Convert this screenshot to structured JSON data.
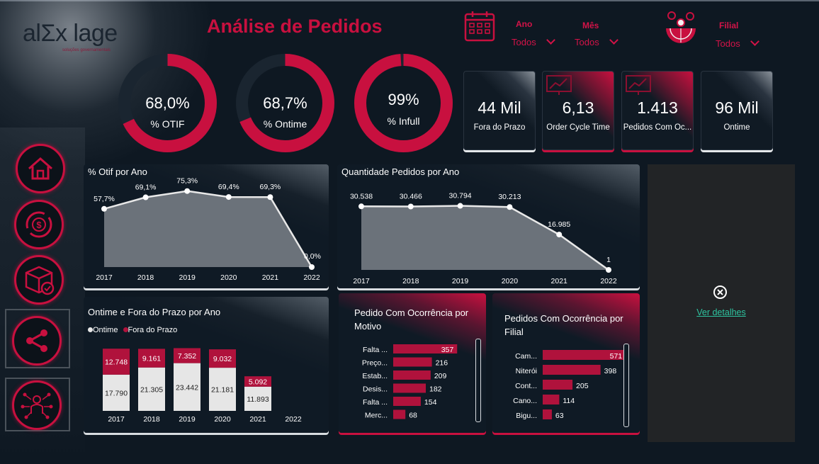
{
  "header": {
    "title": "Análise de Pedidos",
    "logo_text": "alΣx lage",
    "logo_sub": "soluções governamentais"
  },
  "filters": {
    "ano_label": "Ano",
    "ano_value": "Todos",
    "mes_label": "Mês",
    "mes_value": "Todos",
    "filial_label": "Filial",
    "filial_value": "Todos"
  },
  "gauges": [
    {
      "value": "68,0%",
      "label": "% OTIF",
      "fraction": 0.68
    },
    {
      "value": "68,7%",
      "label": "% Ontime",
      "fraction": 0.687
    },
    {
      "value": "99%",
      "label": "% Infull",
      "fraction": 0.99
    }
  ],
  "kpis": [
    {
      "value": "44 Mil",
      "label": "Fora do Prazo"
    },
    {
      "value": "6,13",
      "label": "Order Cycle Time"
    },
    {
      "value": "1.413",
      "label": "Pedidos Com Oc..."
    },
    {
      "value": "96 Mil",
      "label": "Ontime"
    }
  ],
  "nav": {
    "items": [
      "home-icon",
      "money-cycle-icon",
      "box-check-icon",
      "share-icon",
      "network-person-icon"
    ]
  },
  "details": {
    "link": "Ver detalhes"
  },
  "colors": {
    "accent": "#c8103f",
    "background": "#0e1822",
    "area_fill": "#6b727a",
    "ontime_bar": "#e6e6e6",
    "late_bar": "#b0123c"
  },
  "chart_data": [
    {
      "id": "otif",
      "type": "area",
      "title": "% Otif por Ano",
      "x": [
        "2017",
        "2018",
        "2019",
        "2020",
        "2021",
        "2022"
      ],
      "values": [
        57.7,
        69.1,
        75.3,
        69.4,
        69.3,
        0.0
      ],
      "labels": [
        "57,7%",
        "69,1%",
        "75,3%",
        "69,4%",
        "69,3%",
        "0,0%"
      ],
      "ylim": [
        0,
        80
      ]
    },
    {
      "id": "quantidade",
      "type": "area",
      "title": "Quantidade Pedidos por Ano",
      "x": [
        "2017",
        "2018",
        "2019",
        "2020",
        "2021",
        "2022"
      ],
      "values": [
        30538,
        30466,
        30794,
        30213,
        16985,
        1
      ],
      "labels": [
        "30.538",
        "30.466",
        "30.794",
        "30.213",
        "16.985",
        "1"
      ],
      "ylim": [
        0,
        32000
      ]
    },
    {
      "id": "ontime_fora",
      "type": "bar",
      "title": "Ontime e Fora do Prazo por Ano",
      "categories": [
        "2017",
        "2018",
        "2019",
        "2020",
        "2021",
        "2022"
      ],
      "series": [
        {
          "name": "Ontime",
          "values": [
            17790,
            21305,
            23442,
            21181,
            11893,
            null
          ],
          "labels": [
            "17.790",
            "21.305",
            "23.442",
            "21.181",
            "11.893",
            ""
          ]
        },
        {
          "name": "Fora do Prazo",
          "values": [
            12748,
            9161,
            7352,
            9032,
            5092,
            null
          ],
          "labels": [
            "12.748",
            "9.161",
            "7.352",
            "9.032",
            "5.092",
            ""
          ]
        }
      ],
      "legend": "top-left",
      "ylim": [
        0,
        32000
      ]
    },
    {
      "id": "motivo",
      "type": "bar",
      "orientation": "horizontal",
      "title": "Pedido Com Ocorrência por Motivo",
      "categories": [
        "Falta ...",
        "Preço...",
        "Estab...",
        "Desis...",
        "Falta ...",
        "Merc..."
      ],
      "values": [
        357,
        216,
        209,
        182,
        154,
        68
      ],
      "xlim": [
        0,
        360
      ]
    },
    {
      "id": "filial",
      "type": "bar",
      "orientation": "horizontal",
      "title": "Pedidos Com Ocorrência por Filial",
      "categories": [
        "Cam...",
        "Niterói",
        "Cont...",
        "Cano...",
        "Bigu..."
      ],
      "values": [
        571,
        398,
        205,
        114,
        63
      ],
      "xlim": [
        0,
        580
      ]
    }
  ]
}
